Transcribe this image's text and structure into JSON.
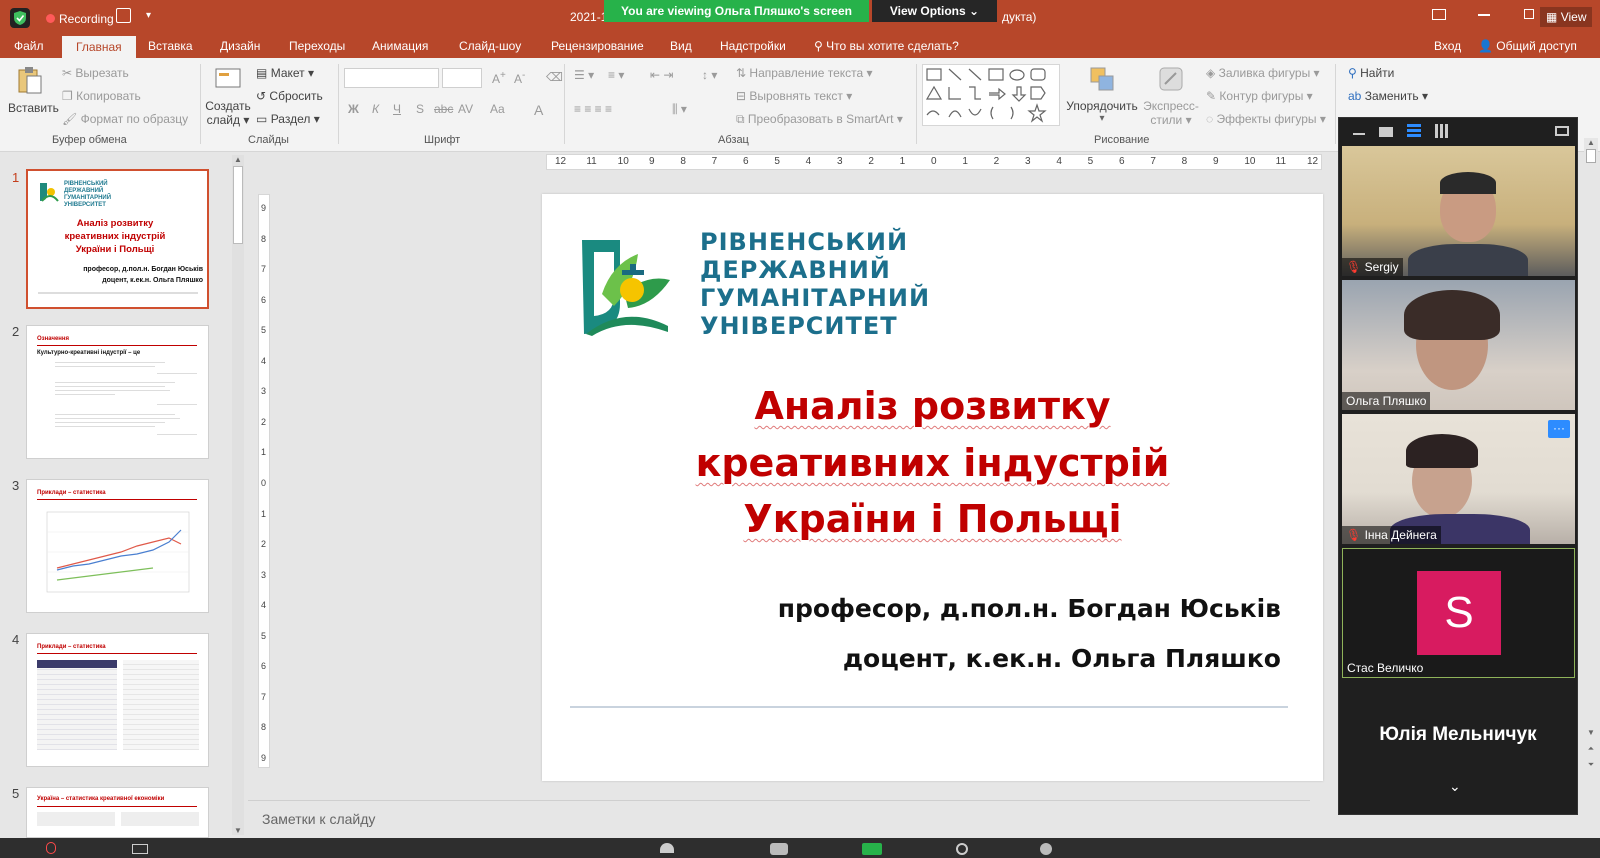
{
  "titlebar": {
    "recording_label": "Recording",
    "file_title_prefix": "2021-1",
    "file_title_suffix": "дукта)",
    "view_label": "View"
  },
  "zoom_banner": {
    "viewing_text": "You are viewing Ольга Пляшко's screen",
    "view_options_label": "View Options"
  },
  "menu": {
    "items": [
      "Файл",
      "Главная",
      "Вставка",
      "Дизайн",
      "Переходы",
      "Анимация",
      "Слайд-шоу",
      "Рецензирование",
      "Вид",
      "Надстройки"
    ],
    "active": "Главная",
    "tell_me": "Что вы хотите сделать?",
    "signin": "Вход",
    "share": "Общий доступ"
  },
  "ribbon": {
    "clipboard": {
      "paste": "Вставить",
      "cut": "Вырезать",
      "copy": "Копировать",
      "format_painter": "Формат по образцу",
      "group": "Буфер обмена"
    },
    "slides": {
      "new_slide_1": "Создать",
      "new_slide_2": "слайд",
      "layout": "Макет",
      "reset": "Сбросить",
      "section": "Раздел",
      "group": "Слайды"
    },
    "font": {
      "bold": "Ж",
      "italic": "К",
      "underline": "Ч",
      "shadow": "S",
      "strike": "abc",
      "spacing": "AV",
      "case": "Aa",
      "color": "A",
      "group": "Шрифт"
    },
    "paragraph": {
      "text_direction": "Направление текста",
      "align_text": "Выровнять текст",
      "smartart": "Преобразовать в SmartArt",
      "group": "Абзац"
    },
    "drawing": {
      "arrange": "Упорядочить",
      "quick_styles_1": "Экспресс-",
      "quick_styles_2": "стили",
      "fill": "Заливка фигуры",
      "outline": "Контур фигуры",
      "effects": "Эффекты фигуры",
      "group": "Рисование"
    },
    "editing": {
      "find": "Найти",
      "replace": "Заменить"
    }
  },
  "ruler": {
    "labels": [
      "12",
      "11",
      "10",
      "9",
      "8",
      "7",
      "6",
      "5",
      "4",
      "3",
      "2",
      "1",
      "0",
      "1",
      "2",
      "3",
      "4",
      "5",
      "6",
      "7",
      "8",
      "9",
      "10",
      "11",
      "12"
    ]
  },
  "vruler": {
    "labels": [
      "9",
      "8",
      "7",
      "6",
      "5",
      "4",
      "3",
      "2",
      "1",
      "0",
      "1",
      "2",
      "3",
      "4",
      "5",
      "6",
      "7",
      "8",
      "9"
    ]
  },
  "thumbnails": [
    {
      "num": "1",
      "title": "Аналіз розвитку креативних індустрій України і Польщі",
      "authors": "професор, д.пол.н. Богдан Юськів доцент, к.ек.н. Ольга Пляшко",
      "logo": "РІВНЕНСЬКИЙ ДЕРЖАВНИЙ ГУМАНІТАРНИЙ УНІВЕРСИТЕТ"
    },
    {
      "num": "2",
      "title": "Означення",
      "subtitle": "Культурно-креативні індустрії – це"
    },
    {
      "num": "3",
      "title": "Приклади – статистика"
    },
    {
      "num": "4",
      "title": "Приклади – статистика"
    },
    {
      "num": "5",
      "title": "Україна – статистика креативної економіки"
    }
  ],
  "slide": {
    "logo_lines": [
      "РІВНЕНСЬКИЙ",
      "ДЕРЖАВНИЙ",
      "ГУМАНІТАРНИЙ",
      "УНІВЕРСИТЕТ"
    ],
    "title_lines": [
      "Аналіз розвитку",
      "креативних індустрій",
      "України і Польщі"
    ],
    "author_lines": [
      "професор, д.пол.н. Богдан Юськів",
      "доцент, к.ек.н. Ольга Пляшко"
    ]
  },
  "notes_placeholder": "Заметки к слайду",
  "participants": [
    {
      "name": "Sergiy",
      "muted": true
    },
    {
      "name": "Ольга Пляшко",
      "muted": false
    },
    {
      "name": "Інна Дейнега",
      "muted": true
    },
    {
      "name": "Стас Величко",
      "initial": "S",
      "avatar_color": "#d81b60"
    }
  ],
  "active_speaker": "Юлія Мельничук",
  "colors": {
    "accent": "#b7472a",
    "title_red": "#c00000",
    "zoom_green": "#27b24a"
  }
}
